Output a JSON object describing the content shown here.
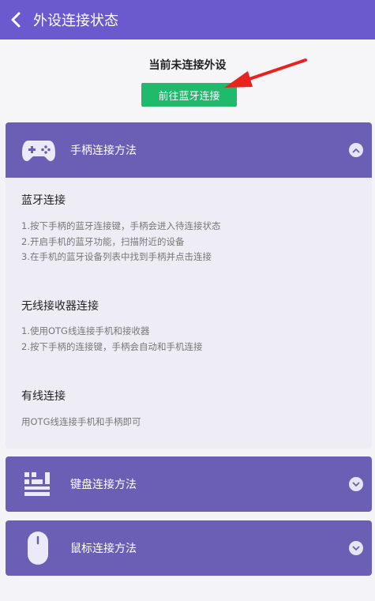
{
  "header": {
    "title": "外设连接状态"
  },
  "status": {
    "text": "当前未连接外设",
    "button_label": "前往蓝牙连接"
  },
  "sections": [
    {
      "title": "手柄连接方法",
      "icon": "gamepad-icon",
      "expanded": true,
      "methods": [
        {
          "title": "蓝牙连接",
          "steps": [
            "1.按下手柄的蓝牙连接键，手柄会进入待连接状态",
            "2.开启手机的蓝牙功能，扫描附近的设备",
            "3.在手机的蓝牙设备列表中找到手柄并点击连接"
          ]
        },
        {
          "title": "无线接收器连接",
          "steps": [
            "1.使用OTG线连接手机和接收器",
            "2.按下手柄的连接键，手柄会自动和手机连接"
          ]
        },
        {
          "title": "有线连接",
          "steps": [
            "用OTG线连接手机和手柄即可"
          ]
        }
      ]
    },
    {
      "title": "键盘连接方法",
      "icon": "keyboard-icon",
      "expanded": false
    },
    {
      "title": "鼠标连接方法",
      "icon": "mouse-icon",
      "expanded": false
    }
  ],
  "colors": {
    "header_bg": "#6a5acd",
    "section_bg": "#6b5fb5",
    "button_bg": "#1fba6b",
    "arrow": "#e8231f"
  }
}
